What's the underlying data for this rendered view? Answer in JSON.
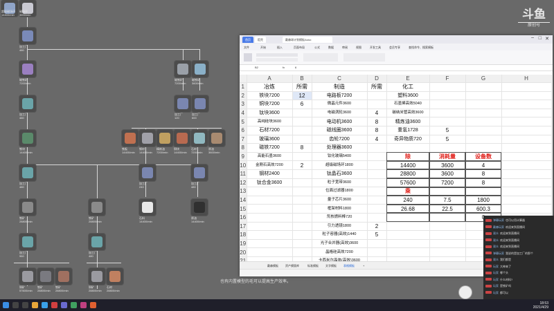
{
  "logo": {
    "main": "斗鱼",
    "sub": "原创号"
  },
  "workflow": {
    "labels": {
      "top_a": "超级磁场环",
      "top_b": "14400/min",
      "top_c": "磁场环",
      "top_d": "3600/min",
      "proc1": "加工厂",
      "proc1_n": "480",
      "mat1": "磁铁矿",
      "mat1_n": "7200/min",
      "proc2": "加工厂",
      "proc2_n": "480",
      "iron": "铁块",
      "iron_n": "14400/min",
      "r1": "磁铁矿",
      "r1_n": "7200/min",
      "r2": "磁铁矿",
      "r2_n": "3600/min",
      "r3": "加工厂",
      "r3_n": "120",
      "r4": "加工厂",
      "r4_n": "600",
      "m1": "铁板",
      "m1_n": "14400/min",
      "m2": "钢材",
      "m2_n": "14400/min",
      "m3": "精炼油",
      "m3_n": "7200/min",
      "m4": "铜块",
      "m4_n": "14400/min",
      "m5": "石材",
      "m5_n": "7200/min",
      "m6": "原油",
      "m6_n": "3600/min",
      "p5": "加工厂",
      "p5_n": "240",
      "p6": "加工厂",
      "p6_n": "480",
      "p7": "加工厂",
      "p7_n": "480",
      "b1": "铁矿",
      "b1_n": "28800/min",
      "b2": "铁矿",
      "b2_n": "28800/min",
      "b3": "石料",
      "b3_n": "14400/min",
      "b4": "原油",
      "b4_n": "14400/min",
      "q1": "加工厂",
      "q1_n": "960",
      "q2": "加工厂",
      "q2_n": "480",
      "z1": "铜矿",
      "z1_n": "57600/min",
      "z2": "铁矿",
      "z2_n": "28800/min",
      "z3": "铁矿",
      "z3_n": "28800/min",
      "z4": "铜矿",
      "z4_n": "28800/min",
      "z5": "石材",
      "z5_n": "28800/min"
    }
  },
  "sheet": {
    "tabs": {
      "home": "首页",
      "doc": "稻壳",
      "file": "戴森球计划模板Aslsx"
    },
    "ribbon": [
      "文件",
      "开始",
      "插入",
      "页面布局",
      "公式",
      "数据",
      "审阅",
      "视图",
      "开发工具",
      "会员专享",
      "查找命令、搜索模板"
    ],
    "name_box": "B2",
    "formula_value": "6",
    "col_headers": [
      "A",
      "B",
      "C",
      "D",
      "E",
      "F",
      "G",
      "H"
    ],
    "rows": [
      [
        "1",
        "冶炼",
        "所需",
        "制造",
        "所需",
        "化工",
        "",
        "",
        ""
      ],
      [
        "2",
        "铁块7200",
        "12",
        "电路板7200",
        "",
        "塑料3600",
        "",
        "",
        ""
      ],
      [
        "3",
        "铜块7200",
        "6",
        "微晶元件3600",
        "",
        "石墨烯高效5040",
        "",
        "",
        ""
      ],
      [
        "4",
        "钛块3600",
        "",
        "电磁涡轮3600",
        "4",
        "碳纳米管高效3600",
        "",
        "",
        ""
      ],
      [
        "5",
        "高纯硅块3600",
        "",
        "电动机3600",
        "8",
        "精炼油3600",
        "",
        "",
        ""
      ],
      [
        "6",
        "石材7200",
        "",
        "磁线圈3600",
        "8",
        "重氢1728",
        "5",
        "",
        ""
      ],
      [
        "7",
        "玻璃3600",
        "",
        "齿轮7200",
        "4",
        "奇异物质720",
        "5",
        "",
        ""
      ],
      [
        "8",
        "磁铁7200",
        "8",
        "处理器3600",
        "",
        "",
        "",
        "",
        ""
      ],
      [
        "9",
        "高能石墨3600",
        "",
        "钛化玻璃5400",
        "",
        "",
        "",
        "",
        ""
      ],
      [
        "10",
        "金刚石高效7200",
        "2",
        "超级磁场环1800",
        "",
        "",
        "",
        "",
        ""
      ],
      [
        "11",
        "钢材2400",
        "",
        "钛晶石3600",
        "",
        "",
        "",
        "",
        ""
      ],
      [
        "12",
        "钛合金3600",
        "",
        "粒子宽带3600",
        "",
        "",
        "",
        "",
        ""
      ],
      [
        "13",
        "",
        "",
        "位面过滤器1800",
        "",
        "",
        "",
        "",
        ""
      ],
      [
        "14",
        "",
        "",
        "量子芯片3600",
        "",
        "",
        "",
        "",
        ""
      ],
      [
        "15",
        "",
        "",
        "框架材料1800",
        "",
        "",
        "",
        "",
        ""
      ],
      [
        "16",
        "",
        "",
        "氘核燃料棒720",
        "",
        "",
        "",
        "",
        ""
      ],
      [
        "17",
        "",
        "",
        "引力透镜1800",
        "2",
        "",
        "",
        "",
        ""
      ],
      [
        "18",
        "",
        "",
        "粒子容器(高效)1440",
        "5",
        "",
        "",
        "",
        ""
      ],
      [
        "19",
        "",
        "",
        "光子合并器(高效)3600",
        "",
        "",
        "",
        "",
        ""
      ],
      [
        "20",
        "",
        "",
        "晶格硅高效7200",
        "",
        "",
        "",
        "",
        ""
      ],
      [
        "21",
        "",
        "",
        "卡西米尔晶体(高效)3600",
        "",
        "",
        "",
        "",
        ""
      ],
      [
        "22",
        "",
        "",
        "棱镜1600",
        "",
        "",
        "",
        "",
        ""
      ]
    ],
    "calc": {
      "h_div": "除",
      "h_cons": "消耗量",
      "h_dev": "设备数",
      "r10": [
        "14400",
        "3600",
        "4"
      ],
      "r11": [
        "28800",
        "3600",
        "8"
      ],
      "r12": [
        "57600",
        "7200",
        "8"
      ],
      "h_mul": "乘",
      "r14": [
        "240",
        "7.5",
        "1800"
      ],
      "r15": [
        "26.68",
        "22.5",
        "600.3"
      ],
      "r16g": "0"
    },
    "sheet_tabs": [
      "戴森模板",
      "资产模版库",
      "标准模板",
      "文字模板",
      "表格模板",
      "+"
    ],
    "status": ""
  },
  "subtitle": "也有内置模型的毛可以提高生产效率。",
  "chat": [
    {
      "name": "弹幕玩家",
      "text": "也可以用计算器"
    },
    {
      "name": "戴森玩家",
      "text": "欢迎来到直播间"
    },
    {
      "name": "观众",
      "text": "欢迎来到直播间"
    },
    {
      "name": "观众",
      "text": "欢迎来到直播间"
    },
    {
      "name": "观众",
      "text": "欢迎来到直播间"
    },
    {
      "name": "弹幕玩家",
      "text": "我说的是加工厂的那个"
    },
    {
      "name": "观众",
      "text": "我们都是"
    },
    {
      "name": "玩家",
      "text": "大神来了"
    },
    {
      "name": "玩家",
      "text": "哪个头"
    },
    {
      "name": "玩家",
      "text": "什么材料?"
    },
    {
      "name": "玩家",
      "text": "是铁矿吗"
    },
    {
      "name": "玩家",
      "text": "都可以"
    }
  ],
  "clock": {
    "time": "18:53",
    "date": "2021/4/29"
  }
}
